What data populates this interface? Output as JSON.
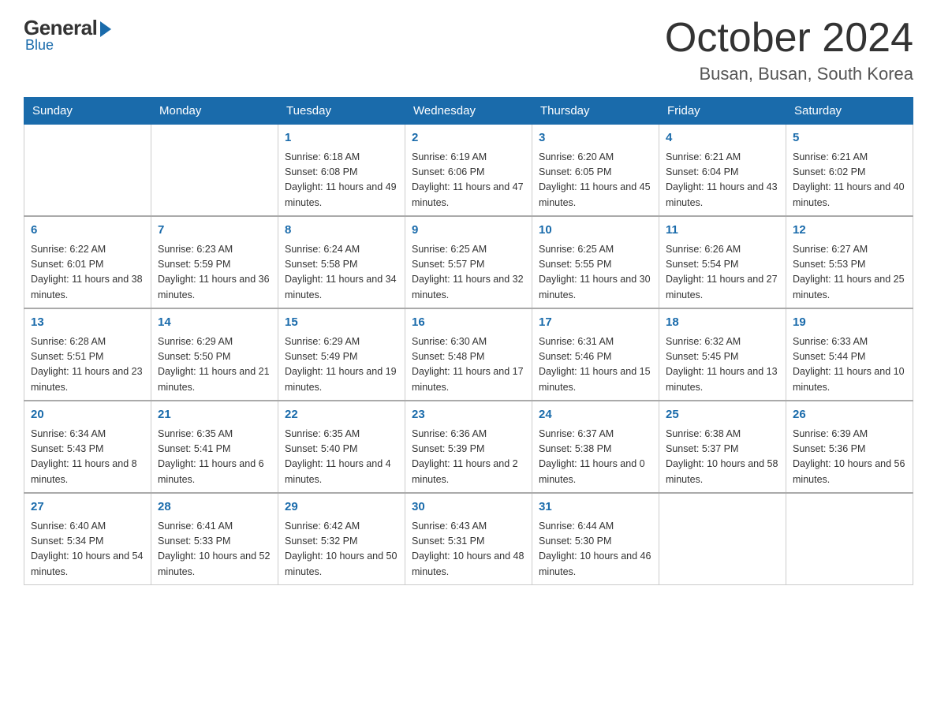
{
  "header": {
    "logo": {
      "general": "General",
      "blue": "Blue"
    },
    "title": "October 2024",
    "location": "Busan, Busan, South Korea"
  },
  "calendar": {
    "days_of_week": [
      "Sunday",
      "Monday",
      "Tuesday",
      "Wednesday",
      "Thursday",
      "Friday",
      "Saturday"
    ],
    "weeks": [
      [
        {
          "day": "",
          "sunrise": "",
          "sunset": "",
          "daylight": ""
        },
        {
          "day": "",
          "sunrise": "",
          "sunset": "",
          "daylight": ""
        },
        {
          "day": "1",
          "sunrise": "Sunrise: 6:18 AM",
          "sunset": "Sunset: 6:08 PM",
          "daylight": "Daylight: 11 hours and 49 minutes."
        },
        {
          "day": "2",
          "sunrise": "Sunrise: 6:19 AM",
          "sunset": "Sunset: 6:06 PM",
          "daylight": "Daylight: 11 hours and 47 minutes."
        },
        {
          "day": "3",
          "sunrise": "Sunrise: 6:20 AM",
          "sunset": "Sunset: 6:05 PM",
          "daylight": "Daylight: 11 hours and 45 minutes."
        },
        {
          "day": "4",
          "sunrise": "Sunrise: 6:21 AM",
          "sunset": "Sunset: 6:04 PM",
          "daylight": "Daylight: 11 hours and 43 minutes."
        },
        {
          "day": "5",
          "sunrise": "Sunrise: 6:21 AM",
          "sunset": "Sunset: 6:02 PM",
          "daylight": "Daylight: 11 hours and 40 minutes."
        }
      ],
      [
        {
          "day": "6",
          "sunrise": "Sunrise: 6:22 AM",
          "sunset": "Sunset: 6:01 PM",
          "daylight": "Daylight: 11 hours and 38 minutes."
        },
        {
          "day": "7",
          "sunrise": "Sunrise: 6:23 AM",
          "sunset": "Sunset: 5:59 PM",
          "daylight": "Daylight: 11 hours and 36 minutes."
        },
        {
          "day": "8",
          "sunrise": "Sunrise: 6:24 AM",
          "sunset": "Sunset: 5:58 PM",
          "daylight": "Daylight: 11 hours and 34 minutes."
        },
        {
          "day": "9",
          "sunrise": "Sunrise: 6:25 AM",
          "sunset": "Sunset: 5:57 PM",
          "daylight": "Daylight: 11 hours and 32 minutes."
        },
        {
          "day": "10",
          "sunrise": "Sunrise: 6:25 AM",
          "sunset": "Sunset: 5:55 PM",
          "daylight": "Daylight: 11 hours and 30 minutes."
        },
        {
          "day": "11",
          "sunrise": "Sunrise: 6:26 AM",
          "sunset": "Sunset: 5:54 PM",
          "daylight": "Daylight: 11 hours and 27 minutes."
        },
        {
          "day": "12",
          "sunrise": "Sunrise: 6:27 AM",
          "sunset": "Sunset: 5:53 PM",
          "daylight": "Daylight: 11 hours and 25 minutes."
        }
      ],
      [
        {
          "day": "13",
          "sunrise": "Sunrise: 6:28 AM",
          "sunset": "Sunset: 5:51 PM",
          "daylight": "Daylight: 11 hours and 23 minutes."
        },
        {
          "day": "14",
          "sunrise": "Sunrise: 6:29 AM",
          "sunset": "Sunset: 5:50 PM",
          "daylight": "Daylight: 11 hours and 21 minutes."
        },
        {
          "day": "15",
          "sunrise": "Sunrise: 6:29 AM",
          "sunset": "Sunset: 5:49 PM",
          "daylight": "Daylight: 11 hours and 19 minutes."
        },
        {
          "day": "16",
          "sunrise": "Sunrise: 6:30 AM",
          "sunset": "Sunset: 5:48 PM",
          "daylight": "Daylight: 11 hours and 17 minutes."
        },
        {
          "day": "17",
          "sunrise": "Sunrise: 6:31 AM",
          "sunset": "Sunset: 5:46 PM",
          "daylight": "Daylight: 11 hours and 15 minutes."
        },
        {
          "day": "18",
          "sunrise": "Sunrise: 6:32 AM",
          "sunset": "Sunset: 5:45 PM",
          "daylight": "Daylight: 11 hours and 13 minutes."
        },
        {
          "day": "19",
          "sunrise": "Sunrise: 6:33 AM",
          "sunset": "Sunset: 5:44 PM",
          "daylight": "Daylight: 11 hours and 10 minutes."
        }
      ],
      [
        {
          "day": "20",
          "sunrise": "Sunrise: 6:34 AM",
          "sunset": "Sunset: 5:43 PM",
          "daylight": "Daylight: 11 hours and 8 minutes."
        },
        {
          "day": "21",
          "sunrise": "Sunrise: 6:35 AM",
          "sunset": "Sunset: 5:41 PM",
          "daylight": "Daylight: 11 hours and 6 minutes."
        },
        {
          "day": "22",
          "sunrise": "Sunrise: 6:35 AM",
          "sunset": "Sunset: 5:40 PM",
          "daylight": "Daylight: 11 hours and 4 minutes."
        },
        {
          "day": "23",
          "sunrise": "Sunrise: 6:36 AM",
          "sunset": "Sunset: 5:39 PM",
          "daylight": "Daylight: 11 hours and 2 minutes."
        },
        {
          "day": "24",
          "sunrise": "Sunrise: 6:37 AM",
          "sunset": "Sunset: 5:38 PM",
          "daylight": "Daylight: 11 hours and 0 minutes."
        },
        {
          "day": "25",
          "sunrise": "Sunrise: 6:38 AM",
          "sunset": "Sunset: 5:37 PM",
          "daylight": "Daylight: 10 hours and 58 minutes."
        },
        {
          "day": "26",
          "sunrise": "Sunrise: 6:39 AM",
          "sunset": "Sunset: 5:36 PM",
          "daylight": "Daylight: 10 hours and 56 minutes."
        }
      ],
      [
        {
          "day": "27",
          "sunrise": "Sunrise: 6:40 AM",
          "sunset": "Sunset: 5:34 PM",
          "daylight": "Daylight: 10 hours and 54 minutes."
        },
        {
          "day": "28",
          "sunrise": "Sunrise: 6:41 AM",
          "sunset": "Sunset: 5:33 PM",
          "daylight": "Daylight: 10 hours and 52 minutes."
        },
        {
          "day": "29",
          "sunrise": "Sunrise: 6:42 AM",
          "sunset": "Sunset: 5:32 PM",
          "daylight": "Daylight: 10 hours and 50 minutes."
        },
        {
          "day": "30",
          "sunrise": "Sunrise: 6:43 AM",
          "sunset": "Sunset: 5:31 PM",
          "daylight": "Daylight: 10 hours and 48 minutes."
        },
        {
          "day": "31",
          "sunrise": "Sunrise: 6:44 AM",
          "sunset": "Sunset: 5:30 PM",
          "daylight": "Daylight: 10 hours and 46 minutes."
        },
        {
          "day": "",
          "sunrise": "",
          "sunset": "",
          "daylight": ""
        },
        {
          "day": "",
          "sunrise": "",
          "sunset": "",
          "daylight": ""
        }
      ]
    ]
  }
}
